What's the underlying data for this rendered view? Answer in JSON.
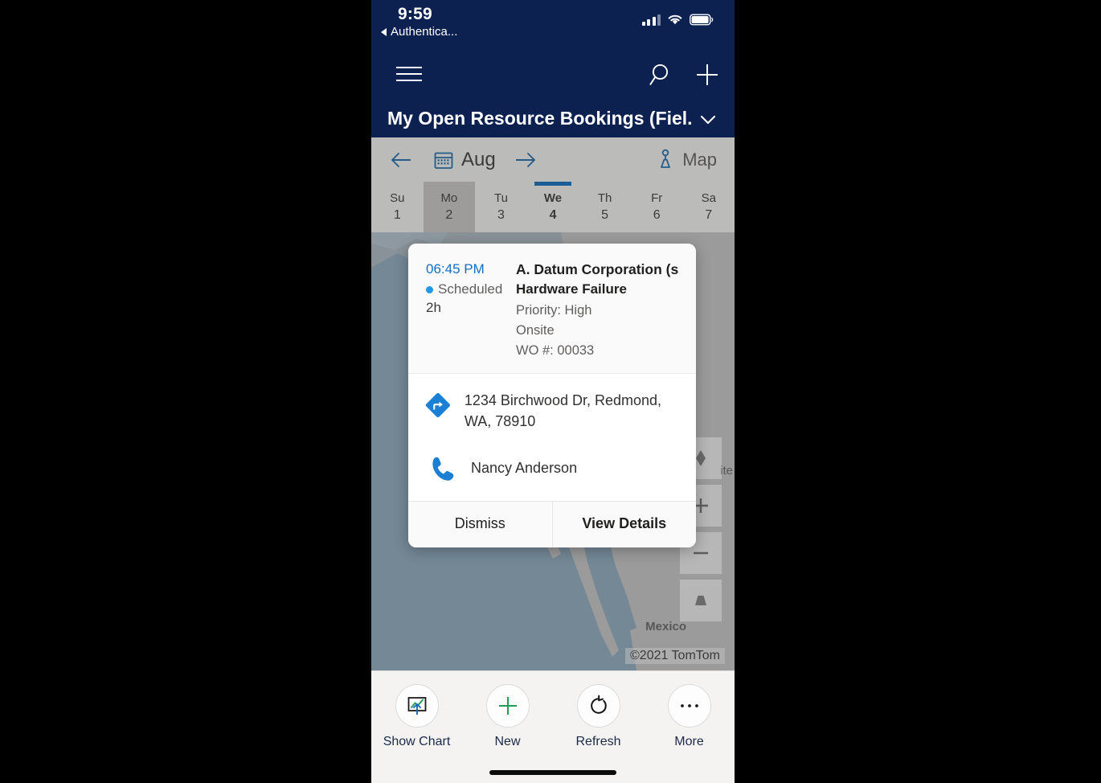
{
  "status_bar": {
    "time": "9:59",
    "back_label": "Authentica...",
    "back_icon": "back-triangle-icon",
    "signal_icon": "cellular-signal-icon",
    "wifi_icon": "wifi-icon",
    "battery_icon": "battery-icon"
  },
  "command_bar": {
    "menu_icon": "hamburger-menu-icon",
    "search_icon": "search-icon",
    "add_icon": "plus-icon"
  },
  "view_selector": {
    "title": "My Open Resource Bookings (Fiel...",
    "chevron_icon": "chevron-down-icon"
  },
  "calendar": {
    "prev_icon": "arrow-left-icon",
    "next_icon": "arrow-right-icon",
    "calendar_icon": "calendar-icon",
    "month": "Aug",
    "map_label": "Map",
    "map_icon": "map-pin-icon",
    "days": [
      {
        "dow": "Su",
        "num": "1",
        "selected": false,
        "today": false
      },
      {
        "dow": "Mo",
        "num": "2",
        "selected": true,
        "today": false
      },
      {
        "dow": "Tu",
        "num": "3",
        "selected": false,
        "today": false
      },
      {
        "dow": "We",
        "num": "4",
        "selected": false,
        "today": true
      },
      {
        "dow": "Th",
        "num": "5",
        "selected": false,
        "today": false
      },
      {
        "dow": "Fr",
        "num": "6",
        "selected": false,
        "today": false
      },
      {
        "dow": "Sa",
        "num": "7",
        "selected": false,
        "today": false
      }
    ]
  },
  "map": {
    "region_label": "Mexico",
    "attribution": "©2021 TomTom",
    "partial_label": "ite",
    "controls": [
      {
        "name": "locate-icon",
        "glyph": "locate"
      },
      {
        "name": "zoom-in-icon",
        "glyph": "plus"
      },
      {
        "name": "zoom-out-icon",
        "glyph": "minus"
      },
      {
        "name": "tilt-icon",
        "glyph": "tilt"
      }
    ]
  },
  "booking_card": {
    "time": "06:45 PM",
    "status": "Scheduled",
    "status_color": "#2199e8",
    "duration": "2h",
    "account": "A. Datum Corporation (sa...",
    "incident_type": "Hardware Failure",
    "priority": "Priority: High",
    "work_location": "Onsite",
    "work_order": "WO #: 00033",
    "address": "1234 Birchwood Dr, Redmond, WA, 78910",
    "address_icon": "directions-icon",
    "contact": "Nancy Anderson",
    "contact_icon": "phone-icon",
    "dismiss_label": "Dismiss",
    "view_details_label": "View Details"
  },
  "bottom_toolbar": {
    "items": [
      {
        "label": "Show Chart",
        "icon": "chart-icon"
      },
      {
        "label": "New",
        "icon": "plus-icon"
      },
      {
        "label": "Refresh",
        "icon": "refresh-icon"
      },
      {
        "label": "More",
        "icon": "ellipsis-icon"
      }
    ]
  },
  "colors": {
    "header_navy": "#0d2150",
    "accent_blue": "#0f6cbd",
    "link_blue": "#1170c7",
    "new_green": "#1f9e55",
    "map_water": "#7d93a3",
    "map_land": "#a9a9a9"
  }
}
